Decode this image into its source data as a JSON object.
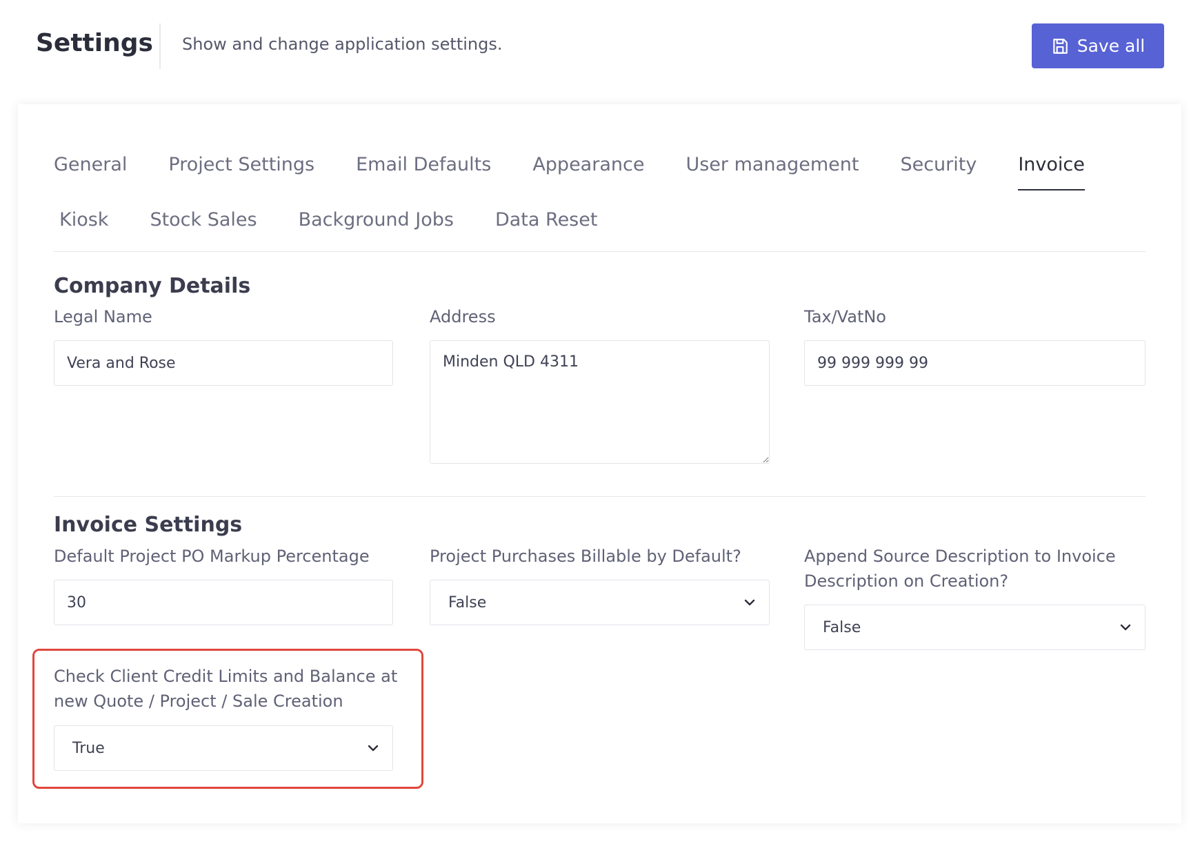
{
  "header": {
    "title": "Settings",
    "subtitle": "Show and change application settings.",
    "save_label": "Save all",
    "save_icon": "floppy-disk-icon"
  },
  "tabs": {
    "row1": [
      "General",
      "Project Settings",
      "Email Defaults",
      "Appearance",
      "User management",
      "Security",
      "Invoice"
    ],
    "row2": [
      "Kiosk",
      "Stock Sales",
      "Background Jobs",
      "Data Reset"
    ],
    "active": "Invoice"
  },
  "company": {
    "title": "Company Details",
    "legal_name": {
      "label": "Legal Name",
      "value": "Vera and Rose"
    },
    "address": {
      "label": "Address",
      "value": "Minden QLD 4311"
    },
    "tax": {
      "label": "Tax/VatNo",
      "value": "99 999 999 99"
    }
  },
  "invoice": {
    "title": "Invoice Settings",
    "markup": {
      "label": "Default Project PO Markup Percentage",
      "value": "30"
    },
    "billable": {
      "label": "Project Purchases Billable by Default?",
      "value": "False"
    },
    "append": {
      "label_line1": "Append Source Description to Invoice",
      "label_line2": "Description on Creation?",
      "value": "False"
    },
    "credit": {
      "label_line1": "Check Client Credit Limits and Balance at",
      "label_line2": "new Quote / Project / Sale Creation",
      "value": "True"
    }
  },
  "colors": {
    "accent": "#5762d5",
    "highlight": "#e0473c"
  }
}
